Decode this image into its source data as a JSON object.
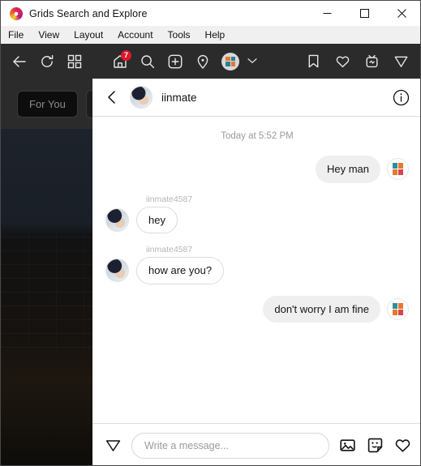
{
  "window": {
    "title": "Grids  Search and Explore",
    "logo_icon": "grids-logo-icon",
    "minimize_icon": "minimize-icon",
    "maximize_icon": "maximize-icon",
    "close_icon": "close-icon"
  },
  "menu": {
    "items": [
      {
        "label": "File"
      },
      {
        "label": "View"
      },
      {
        "label": "Layout"
      },
      {
        "label": "Account"
      },
      {
        "label": "Tools"
      },
      {
        "label": "Help"
      }
    ]
  },
  "toolbar": {
    "back_icon": "back-arrow-icon",
    "refresh_icon": "refresh-icon",
    "grid_icon": "grid-view-icon",
    "home_icon": "home-icon",
    "home_badge": "7",
    "search_icon": "search-icon",
    "add_icon": "add-post-icon",
    "location_icon": "location-pin-icon",
    "account_avatar_icon": "account-avatar-icon",
    "chevron_icon": "chevron-down-icon",
    "bookmark_icon": "bookmark-icon",
    "heart_icon": "heart-icon",
    "igtv_icon": "igtv-icon",
    "direct_icon": "direct-send-icon"
  },
  "background": {
    "tabs": [
      {
        "label": "For You"
      }
    ]
  },
  "chat": {
    "back_icon": "back-chevron-icon",
    "avatar_icon": "user-avatar-icon",
    "title": "iinmate",
    "info_icon": "info-circle-icon",
    "timestamp": "Today at 5:52 PM",
    "messages": [
      {
        "direction": "out",
        "text": "Hey man",
        "avatar_icon": "self-avatar-icon"
      },
      {
        "direction": "in",
        "sender": "iinmate4587",
        "text": "hey",
        "avatar_icon": "user-avatar-icon"
      },
      {
        "direction": "in",
        "sender": "iinmate4587",
        "text": "how are you?",
        "avatar_icon": "user-avatar-icon"
      },
      {
        "direction": "out",
        "text": "don't worry I am fine",
        "avatar_icon": "self-avatar-icon"
      }
    ],
    "input": {
      "send_icon": "send-icon",
      "placeholder": "Write a message...",
      "value": "",
      "photo_icon": "photo-icon",
      "sticker_icon": "sticker-icon",
      "heart_icon": "heart-icon"
    }
  },
  "colors": {
    "accent_red": "#e1172b",
    "panel_bg": "#ffffff",
    "toolbar_bg": "#2b2b2b",
    "bubble_out_bg": "#efefef"
  }
}
